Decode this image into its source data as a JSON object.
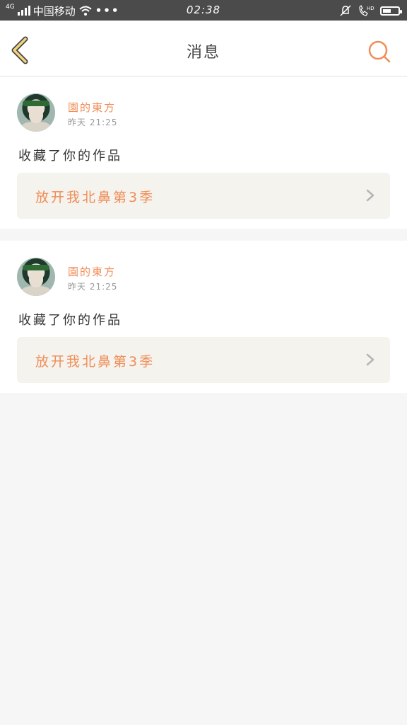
{
  "status_bar": {
    "carrier": "中国移动",
    "network": "4G",
    "time": "02:38",
    "icons": [
      "signal-icon",
      "wifi-icon",
      "more-icon",
      "mute-icon",
      "hd-call-icon",
      "battery-icon"
    ]
  },
  "header": {
    "title": "消息",
    "back_icon": "chevron-left-icon",
    "search_icon": "search-icon"
  },
  "colors": {
    "accent": "#f08d57",
    "back_arrow": "#f3d57a",
    "card_bg": "#ffffff",
    "page_bg": "#f6f6f6",
    "link_bg": "#f4f3ee"
  },
  "messages": [
    {
      "username": "園的東方",
      "time": "昨天 21:25",
      "action": "收藏了你的作品",
      "work_title": "放开我北鼻第3季"
    },
    {
      "username": "園的東方",
      "time": "昨天 21:25",
      "action": "收藏了你的作品",
      "work_title": "放开我北鼻第3季"
    }
  ]
}
